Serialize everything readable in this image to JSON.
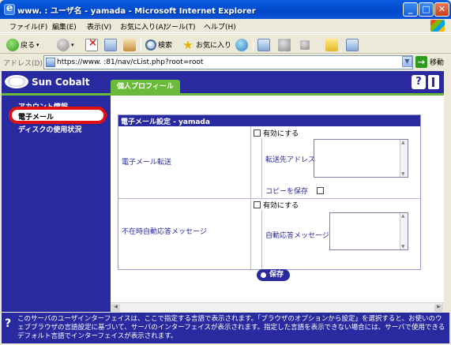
{
  "window": {
    "title": "www.              : ユーザ名 - yamada - Microsoft Internet Explorer",
    "controls": {
      "minimize": "_",
      "maximize": "□",
      "close": "✕"
    }
  },
  "menubar": [
    "ファイル(F)",
    "編集(E)",
    "表示(V)",
    "お気に入り(A)",
    "ツール(T)",
    "ヘルプ(H)"
  ],
  "toolbar": {
    "back_label": "戻る",
    "search_label": "検索",
    "favorites_label": "お気に入り"
  },
  "addressbar": {
    "label": "アドレス(D)",
    "url": "https://www.              :81/nav/cList.php?root=root",
    "go_label": "移動"
  },
  "app": {
    "brand": "Sun Cobalt",
    "tab": "個人プロフィール",
    "help_icon_label": "?"
  },
  "sidebar": {
    "items": [
      {
        "label": "アカウント情報"
      },
      {
        "label": "電子メール"
      },
      {
        "label": "ディスクの使用状況"
      }
    ]
  },
  "form": {
    "title": "電子メール設定 - yamada",
    "forward": {
      "row_label": "電子メール転送",
      "enable_label": "有効にする",
      "address_label": "転送先アドレス",
      "copy_label": "コピーを保存"
    },
    "autoreply": {
      "row_label": "不在時自動応答メッセージ",
      "enable_label": "有効にする",
      "message_label": "自動応答メッセージ"
    },
    "save_label": "保存"
  },
  "info": {
    "icon": "?",
    "message": "このサーバのユーザインターフェイスは、ここで指定する言語で表示されます。「ブラウザのオプションから設定」を選択すると、お使いのウェブブラウザの言語設定に基づいて、サーバのインターフェイスが表示されます。指定した言語を表示できない場合には、サーバで使用できるデフォルト言語でインターフェイスが表示されます。"
  }
}
